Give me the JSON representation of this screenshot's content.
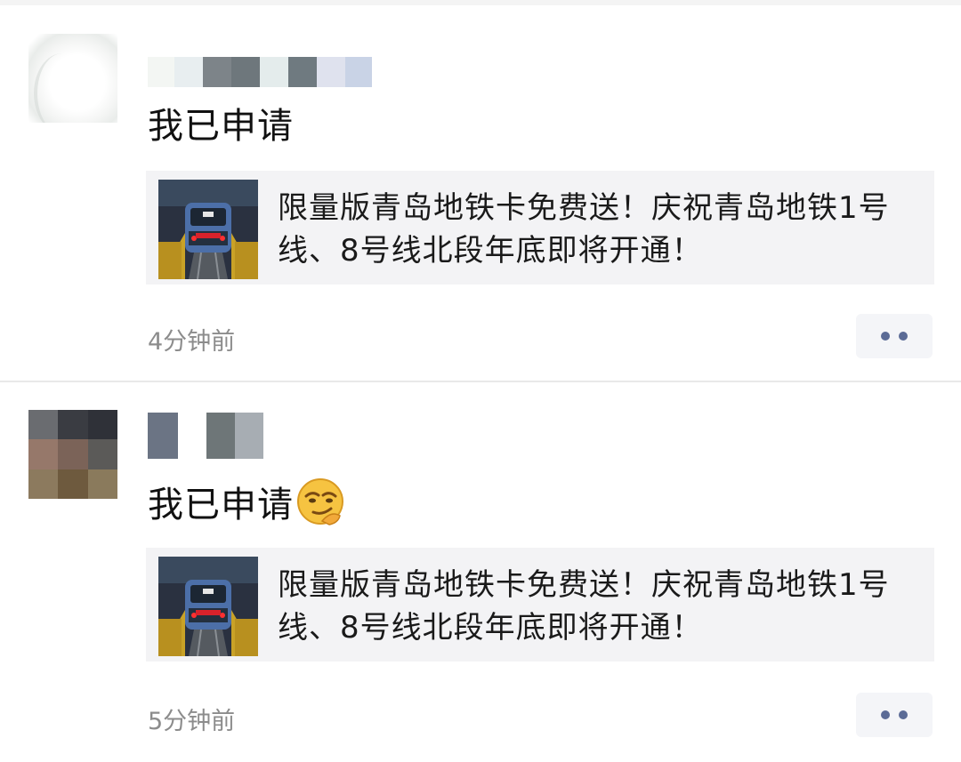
{
  "posts": [
    {
      "message": "我已申请",
      "has_emoji": false,
      "link_card": {
        "title": "限量版青岛地铁卡免费送！庆祝青岛地铁1号线、8号线北段年底即将开通！",
        "thumbnail_icon": "subway-train-thumbnail"
      },
      "timestamp": "4分钟前",
      "more_icon": "more-dots-icon"
    },
    {
      "message": "我已申请",
      "has_emoji": true,
      "emoji_icon": "smirk-emoji-icon",
      "link_card": {
        "title": "限量版青岛地铁卡免费送！庆祝青岛地铁1号线、8号线北段年底即将开通！",
        "thumbnail_icon": "subway-train-thumbnail"
      },
      "timestamp": "5分钟前",
      "more_icon": "more-dots-icon"
    }
  ],
  "colors": {
    "text": "#111111",
    "timestamp": "#8c8c8c",
    "card_bg": "#f3f3f5",
    "more_dots": "#5b6b96"
  }
}
